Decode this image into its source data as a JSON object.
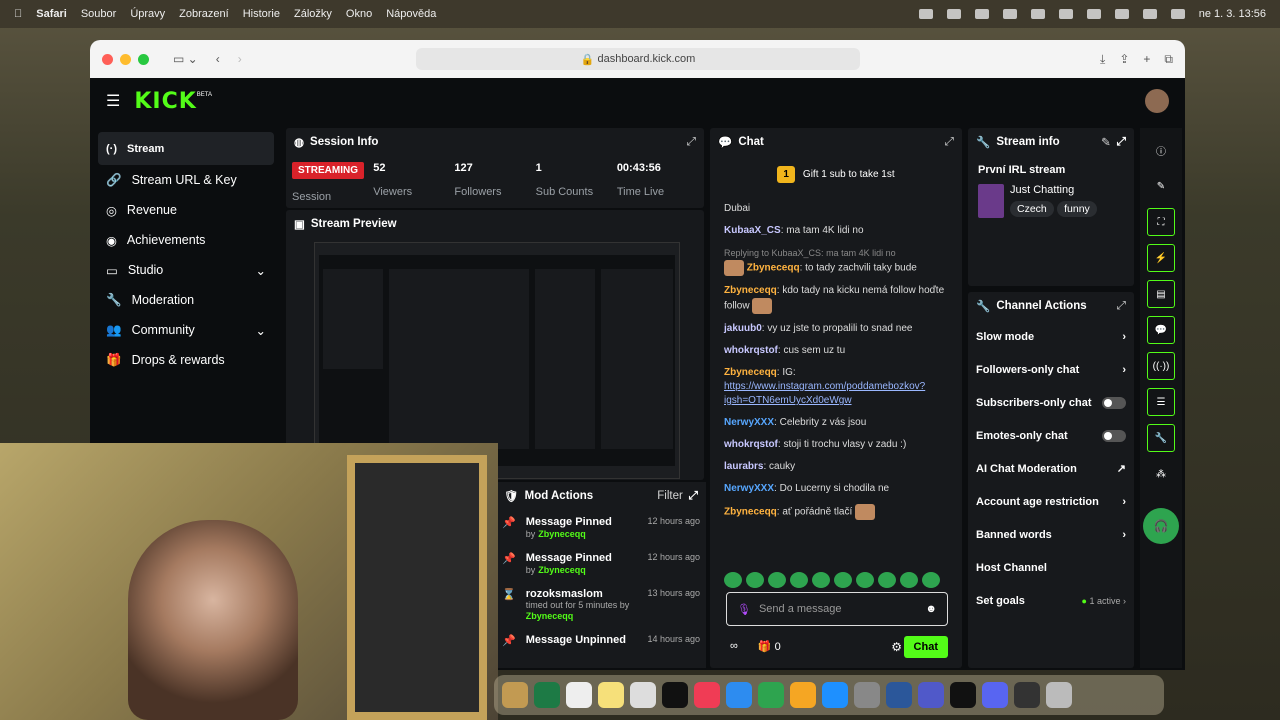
{
  "menubar": {
    "apple": "",
    "app": "Safari",
    "items": [
      "Soubor",
      "Úpravy",
      "Zobrazení",
      "Historie",
      "Záložky",
      "Okno",
      "Nápověda"
    ],
    "clock": "ne 1. 3.  13:56"
  },
  "browser": {
    "url": "dashboard.kick.com"
  },
  "kick": {
    "logo": "KICK",
    "beta": "BETA"
  },
  "sidebar": {
    "items": [
      {
        "label": "Stream",
        "active": true
      },
      {
        "label": "Stream URL & Key"
      },
      {
        "label": "Revenue"
      },
      {
        "label": "Achievements"
      },
      {
        "label": "Studio",
        "expand": true
      },
      {
        "label": "Moderation"
      },
      {
        "label": "Community",
        "expand": true
      },
      {
        "label": "Drops & rewards"
      }
    ]
  },
  "session": {
    "title": "Session Info",
    "status": "STREAMING",
    "status_sub": "Session",
    "stats": [
      {
        "value": "52",
        "label": "Viewers"
      },
      {
        "value": "127",
        "label": "Followers"
      },
      {
        "value": "1",
        "label": "Sub Counts"
      },
      {
        "value": "00:43:56",
        "label": "Time Live"
      }
    ]
  },
  "preview": {
    "title": "Stream Preview"
  },
  "chat": {
    "title": "Chat",
    "gift_count": "1",
    "gift": "Gift 1 sub to take 1st",
    "messages": [
      {
        "user": "",
        "text": "Dubai"
      },
      {
        "user": "KubaaX_CS",
        "text": "ma tam 4K lidi no"
      },
      {
        "reply": "Replying to KubaaX_CS: ma tam 4K lidi no",
        "user": "Zbyneceqq",
        "text": "to tady zachvili taky bude"
      },
      {
        "user": "Zbyneceqq",
        "text": "kdo tady na kicku nemá follow hoďte follow"
      },
      {
        "user": "jakuub0",
        "text": "vy uz jste to propalili to snad nee"
      },
      {
        "user": "whokrqstof",
        "text": "cus sem uz tu"
      },
      {
        "user": "Zbyneceqq",
        "text": "IG:",
        "link": "https://www.instagram.com/poddamebozkov?igsh=OTN6emUycXd0eWgw"
      },
      {
        "user": "NerwyXXX",
        "text": "Celebrity z vás jsou"
      },
      {
        "user": "whokrqstof",
        "text": "stoji ti trochu vlasy v zadu :)"
      },
      {
        "user": "laurabrs",
        "text": "cauky"
      },
      {
        "user": "NerwyXXX",
        "text": "Do Lucerny si chodila ne"
      },
      {
        "user": "Zbyneceqq",
        "text": "ať pořádně tlačí"
      }
    ],
    "placeholder": "Send a message",
    "count": "0",
    "send": "Chat"
  },
  "mod": {
    "title": "Mod Actions",
    "filter": "Filter",
    "items": [
      {
        "title": "Message Pinned",
        "by": "by",
        "user": "Zbyneceqq",
        "time": "12 hours ago"
      },
      {
        "title": "Message Pinned",
        "by": "by",
        "user": "Zbyneceqq",
        "time": "12 hours ago"
      },
      {
        "title": "rozoksmaslom",
        "sub": "timed out for 5 minutes by",
        "user": "Zbyneceqq",
        "time": "13 hours ago"
      },
      {
        "title": "Message Unpinned",
        "time": "14 hours ago"
      }
    ]
  },
  "streaminfo": {
    "title": "Stream info",
    "name": "První IRL stream",
    "category": "Just Chatting",
    "tags": [
      "Czech",
      "funny"
    ]
  },
  "actions": {
    "title": "Channel Actions",
    "items": [
      {
        "label": "Slow mode",
        "kind": "arrow"
      },
      {
        "label": "Followers-only chat",
        "kind": "arrow"
      },
      {
        "label": "Subscribers-only chat",
        "kind": "toggle"
      },
      {
        "label": "Emotes-only chat",
        "kind": "toggle"
      },
      {
        "label": "AI Chat Moderation",
        "kind": "ext"
      },
      {
        "label": "Account age restriction",
        "kind": "arrow"
      },
      {
        "label": "Banned words",
        "kind": "arrow"
      },
      {
        "label": "Host Channel",
        "kind": "none"
      },
      {
        "label": "Set goals",
        "kind": "arrow",
        "badge": "1 active"
      }
    ]
  }
}
